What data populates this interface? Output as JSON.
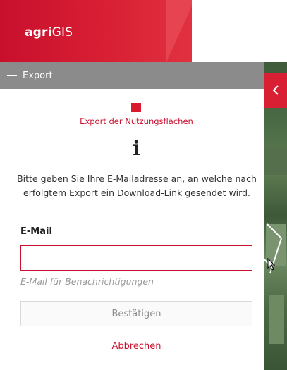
{
  "app": {
    "logo_bold": "agri",
    "logo_regular": "GIS"
  },
  "panel": {
    "title": "Export"
  },
  "export": {
    "title": "Export der Nutzungsflächen",
    "info_text": "Bitte geben Sie Ihre E-Mailadresse an, an welche nach erfolgtem Export ein Download-Link gesendet wird.",
    "email_label": "E-Mail",
    "email_value": "",
    "email_hint": "E-Mail für Benachrichtigungen",
    "confirm_label": "Bestätigen",
    "cancel_label": "Abbrechen"
  },
  "icons": {
    "collapse": "minus-icon",
    "toggle": "chevron-left-icon",
    "info": "info-icon",
    "marker": "red-square-icon"
  },
  "colors": {
    "brand_red": "#c8102e",
    "bar_gray": "#8b8b8b"
  }
}
